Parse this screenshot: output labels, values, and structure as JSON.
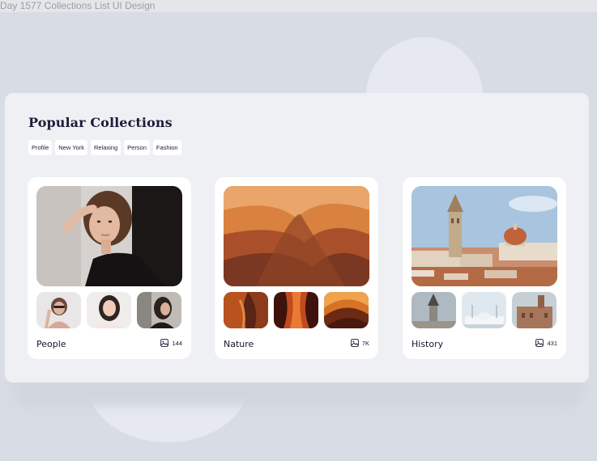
{
  "frame": {
    "title": "Day 1577 Collections List UI Design"
  },
  "section": {
    "title": "Popular Collections",
    "tags": [
      "Profile",
      "New York",
      "Relaxing",
      "Person",
      "Fashion"
    ]
  },
  "collections": [
    {
      "name": "People",
      "count": "144",
      "hero": "woman-portrait-photo",
      "thumbs": [
        "woman-sunglasses-photo",
        "woman-portrait-photo",
        "woman-profile-photo"
      ]
    },
    {
      "name": "Nature",
      "count": "7K",
      "hero": "sandstone-canyon-photo",
      "thumbs": [
        "canyon-photo",
        "canyon-photo",
        "canyon-photo"
      ]
    },
    {
      "name": "History",
      "count": "431",
      "hero": "old-city-tower-photo",
      "thumbs": [
        "tower-photo",
        "white-mosque-photo",
        "old-building-photo"
      ]
    }
  ],
  "colors": {
    "background": "#d8dce4",
    "panel": "#eff0f3",
    "card": "#ffffff",
    "text": "#1b1d3a"
  }
}
